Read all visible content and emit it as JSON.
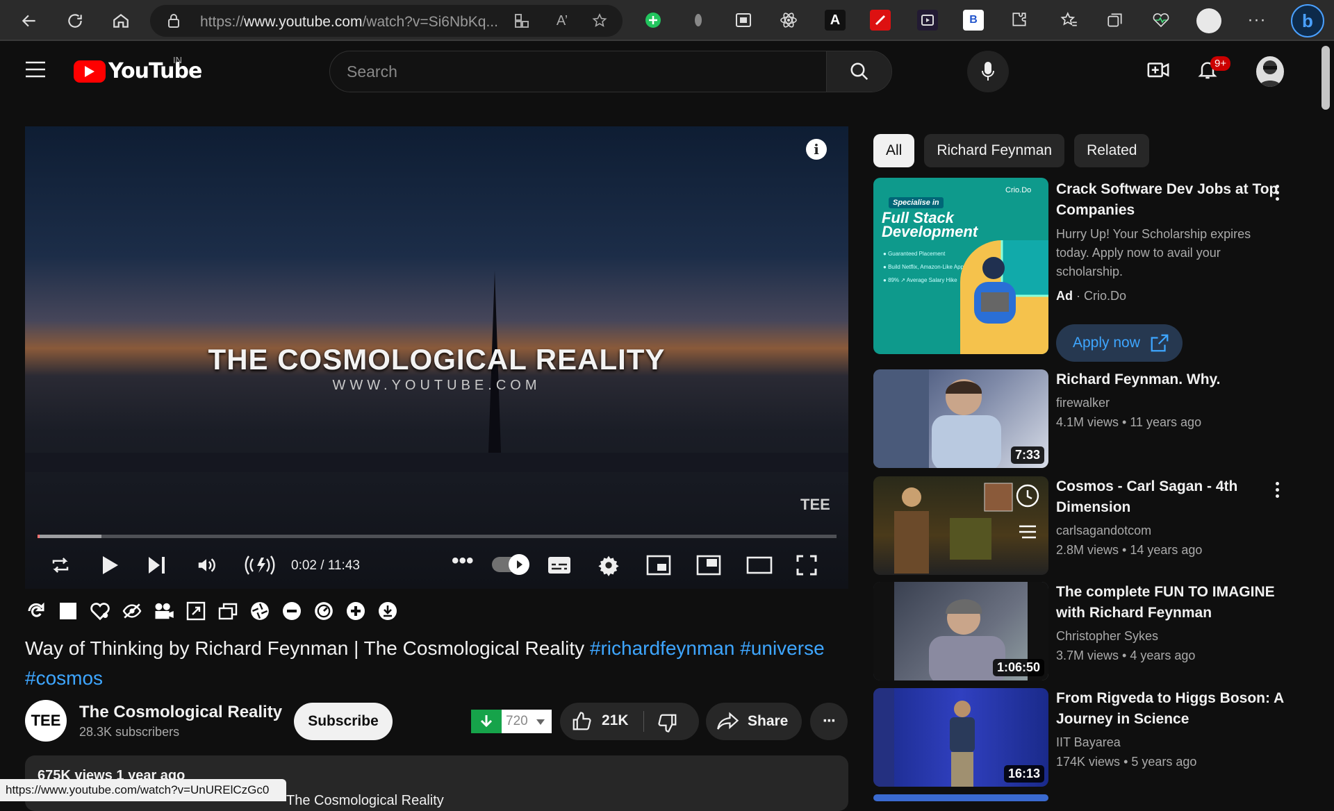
{
  "browser": {
    "url_prefix": "https://",
    "url_host": "www.youtube.com",
    "url_rest": "/watch?v=Si6NbKq...",
    "status_url": "https://www.youtube.com/watch?v=UnURElCzGc0"
  },
  "header": {
    "logo_text": "YouTube",
    "region": "IN",
    "search_placeholder": "Search",
    "notif_count": "9+"
  },
  "player": {
    "overlay_title": "THE COSMOLOGICAL REALITY",
    "overlay_subtitle": "WWW.YOUTUBE.COM",
    "watermark": "TEE",
    "time": "0:02 / 11:43",
    "progress_fraction": 0.003
  },
  "video": {
    "title": "Way of Thinking by Richard Feynman | The Cosmological Reality",
    "tags": [
      "#richardfeynman",
      "#universe",
      "#cosmos"
    ],
    "channel": "The Cosmological Reality",
    "channel_avatar": "TEE",
    "subscribers": "28.3K subscribers",
    "subscribe_label": "Subscribe",
    "download_count": "720",
    "likes": "21K",
    "share_label": "Share",
    "views": "675K views  1 year ago",
    "desc_partial": "The Cosmological Reality"
  },
  "sidebar": {
    "chips": [
      "All",
      "Richard Feynman",
      "Related"
    ],
    "ad": {
      "tag": "Specialise in",
      "headline_1": "Full Stack",
      "headline_2": "Development",
      "bullets": [
        "Guaranteed Placement",
        "Build Netflix, Amazon-Like Apps",
        "89% ↗ Average Salary Hike"
      ],
      "brand": "Crio.Do",
      "title": "Crack Software Dev Jobs at Top Companies",
      "desc": "Hurry Up! Your Scholarship expires today. Apply now to avail your scholarship.",
      "ad_label": "Ad",
      "advertiser": "Crio.Do",
      "cta": "Apply now"
    },
    "videos": [
      {
        "title": "Richard Feynman. Why.",
        "channel": "firewalker",
        "views": "4.1M views",
        "age": "11 years ago",
        "duration": "7:33"
      },
      {
        "title": "Cosmos - Carl Sagan - 4th Dimension",
        "channel": "carlsagandotcom",
        "views": "2.8M views",
        "age": "14 years ago",
        "duration": ""
      },
      {
        "title": "The complete FUN TO IMAGINE with Richard Feynman",
        "channel": "Christopher Sykes",
        "views": "3.7M views",
        "age": "4 years ago",
        "duration": "1:06:50"
      },
      {
        "title": "From Rigveda to Higgs Boson: A Journey in Science",
        "channel": "IIT Bayarea",
        "views": "174K views",
        "age": "5 years ago",
        "duration": "16:13"
      }
    ]
  },
  "icons": {
    "back": "arrow-left-icon",
    "refresh": "refresh-icon",
    "home": "home-icon",
    "loop": "loop-icon",
    "play": "play-icon",
    "next": "next-icon",
    "volume": "volume-icon",
    "settings": "gear-icon",
    "fullscreen": "fullscreen-icon",
    "bell": "bell-icon",
    "create": "create-icon"
  },
  "colors": {
    "accent": "#ff0000",
    "link": "#3ea6ff",
    "bg": "#0f0f0f",
    "chip": "#272727"
  }
}
